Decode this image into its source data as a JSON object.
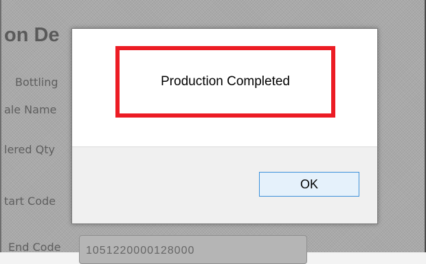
{
  "background": {
    "title": "on De",
    "labels": [
      "Bottling",
      "ale Name",
      "lered Qty",
      "tart Code",
      "End Code"
    ],
    "field_value": "1051220000128000"
  },
  "dialog": {
    "message": "Production Completed",
    "ok_label": "OK"
  },
  "colors": {
    "highlight": "#ec1c24",
    "button_border": "#3b8fd9"
  }
}
